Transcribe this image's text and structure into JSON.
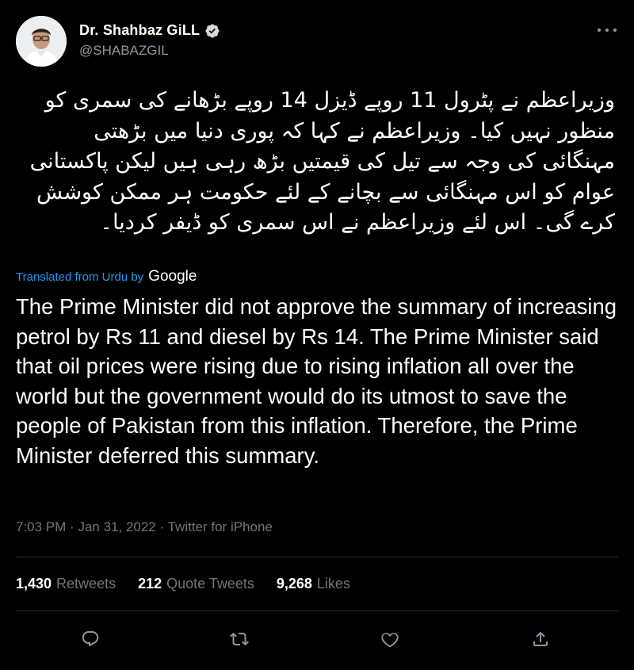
{
  "user": {
    "display_name": "Dr. Shahbaz GiLL",
    "handle": "@SHABAZGIL",
    "verified": true,
    "avatar_icon": "profile-photo"
  },
  "tweet": {
    "urdu_text": "وزیراعظم نے پٹرول 11 روپے ڈیزل 14 روپے بڑھانے کی سمری کو منظور نہیں کیا۔ وزیراعظم نے کہا کہ پوری دنیا میں بڑھتی مہنگائی کی وجہ سے تیل کی قیمتیں بڑھ رہی ہیں لیکن پاکستانی عوام کو اس مہنگائی سے بچانے کے لئے حکومت ہر ممکن کوشش کرے گی۔ اس لئے وزیراعظم نے اس سمری کو ڈیفر کردیا۔",
    "translated_label": "Translated from Urdu by",
    "translator": "Google",
    "english_text": "The Prime Minister did not approve the summary of increasing petrol by Rs 11 and diesel by Rs 14. The Prime Minister said that oil prices were rising due to rising inflation all over the world but the government would do its utmost to save the people of Pakistan from this inflation. Therefore, the Prime Minister deferred this summary.",
    "time": "7:03 PM",
    "date": "Jan 31, 2022",
    "source": "Twitter for iPhone",
    "separator": "·"
  },
  "stats": {
    "retweets_count": "1,430",
    "retweets_label": "Retweets",
    "quotes_count": "212",
    "quotes_label": "Quote Tweets",
    "likes_count": "9,268",
    "likes_label": "Likes"
  },
  "actions": [
    "reply-icon",
    "retweet-icon",
    "like-icon",
    "share-icon"
  ],
  "colors": {
    "background": "#000000",
    "text": "#ffffff",
    "muted": "#71767b",
    "link": "#1d9bf0",
    "divider": "#2f3336"
  }
}
